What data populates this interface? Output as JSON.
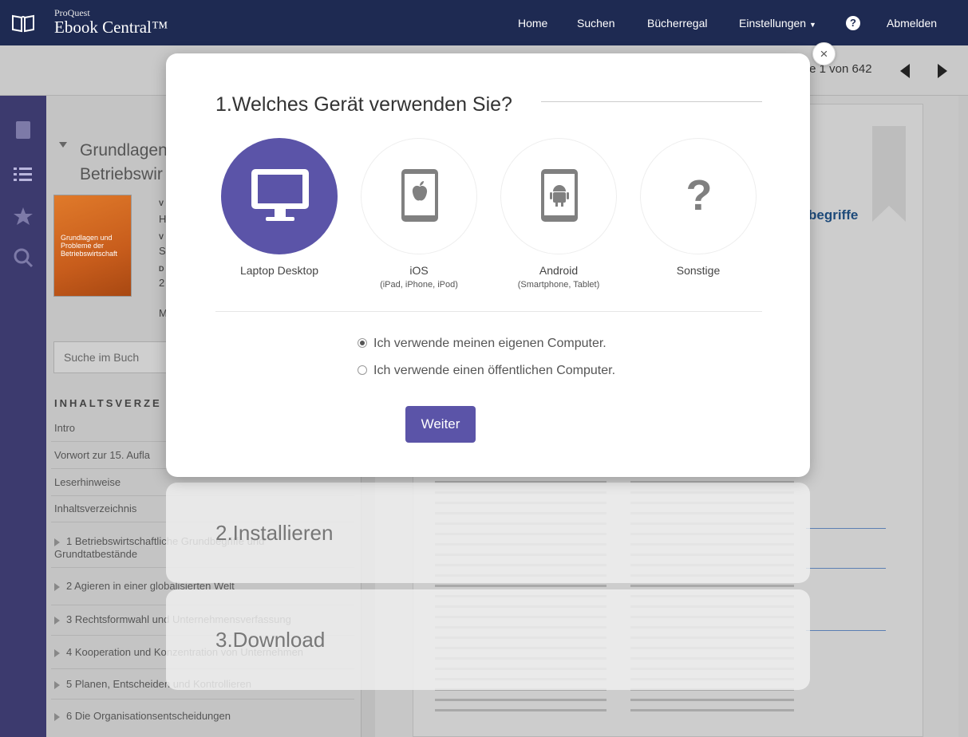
{
  "topbar": {
    "brand_small": "ProQuest",
    "brand_big": "Ebook Central™",
    "nav": {
      "home": "Home",
      "search": "Suchen",
      "bookshelf": "Bücherregal",
      "settings": "Einstellungen",
      "logout": "Abmelden"
    },
    "help": "?"
  },
  "toolbar": {
    "page_indicator": "te 1 von 642"
  },
  "sidebar": {
    "title_line1": "Grundlagen",
    "title_line2": "Betriebswir",
    "cover_text": "Grundlagen und Probleme der Betriebswirtschaft",
    "meta_fragments": [
      "V",
      "H",
      "V",
      "S",
      "D",
      "2",
      "M"
    ],
    "search_placeholder": "Suche im Buch",
    "toc_heading": "INHALTSVERZE",
    "toc": [
      "Intro",
      "Vorwort zur 15. Aufla",
      "Leserhinweise",
      "Inhaltsverzeichnis",
      "1 Betriebswirtschaftliche Grundbegriffe und",
      "Grundtatbestände",
      "2 Agieren in einer globalisierten Welt",
      "3 Rechtsformwahl und Unternehmensverfassung",
      "4 Kooperation und Konzentration von Unternehmen",
      "5 Planen, Entscheiden und Kontrollieren",
      "6 Die Organisationsentscheidungen"
    ]
  },
  "reader": {
    "heading_fragment": "begriffe"
  },
  "modal": {
    "step1_title": "1.Welches Gerät verwenden Sie?",
    "devices": [
      {
        "label": "Laptop Desktop",
        "sub": "",
        "icon": "monitor-icon",
        "active": true
      },
      {
        "label": "iOS",
        "sub": "(iPad, iPhone, iPod)",
        "icon": "apple-tablet-icon",
        "active": false
      },
      {
        "label": "Android",
        "sub": "(Smartphone, Tablet)",
        "icon": "android-phone-icon",
        "active": false
      },
      {
        "label": "Sonstige",
        "sub": "",
        "icon": "question-mark-icon",
        "active": false
      }
    ],
    "radio_own": "Ich verwende meinen eigenen Computer.",
    "radio_public": "Ich verwende einen öffentlichen Computer.",
    "radio_selected": "own",
    "continue_button": "Weiter",
    "close": "×",
    "accent_color": "#5b54a8"
  },
  "steps": {
    "step2": "2.Installieren",
    "step3": "3.Download"
  }
}
